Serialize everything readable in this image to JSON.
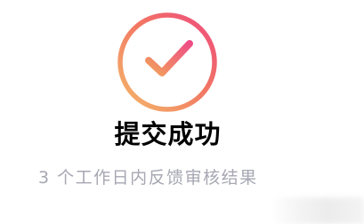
{
  "result": {
    "icon": "checkmark-circle-icon",
    "title": "提交成功",
    "subtitle": "3 个工作日内反馈审核结果"
  },
  "colors": {
    "gradient_start": "#f1a15c",
    "gradient_end": "#ee4a7e",
    "title": "#000000",
    "subtitle": "#a7a7b3",
    "background": "#ffffff"
  }
}
